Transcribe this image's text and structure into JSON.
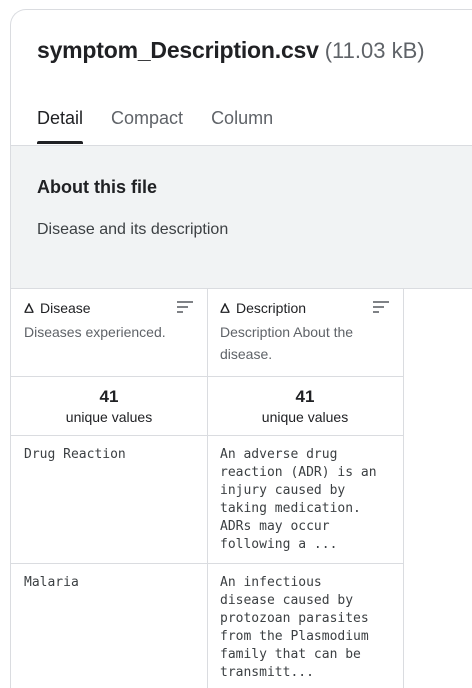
{
  "file": {
    "name": "symptom_Description.csv",
    "size": "(11.03 kB)"
  },
  "tabs": [
    "Detail",
    "Compact",
    "Column"
  ],
  "about": {
    "title": "About this file",
    "description": "Disease and its description"
  },
  "columns": [
    {
      "title": "Disease",
      "type_icon": "text-type-icon",
      "description": "Diseases experienced.",
      "stat_value": "41",
      "stat_label": "unique values",
      "rows": [
        "Drug Reaction",
        "Malaria"
      ]
    },
    {
      "title": "Description",
      "type_icon": "text-type-icon",
      "description": "Description About the\ndisease.",
      "stat_value": "41",
      "stat_label": "unique values",
      "rows": [
        "An adverse drug\nreaction (ADR) is an\ninjury caused by\ntaking medication.\nADRs may occur\nfollowing a ...",
        "An infectious\ndisease caused by\nprotozoan parasites\nfrom the Plasmodium\nfamily that can be\ntransmitt..."
      ]
    }
  ]
}
